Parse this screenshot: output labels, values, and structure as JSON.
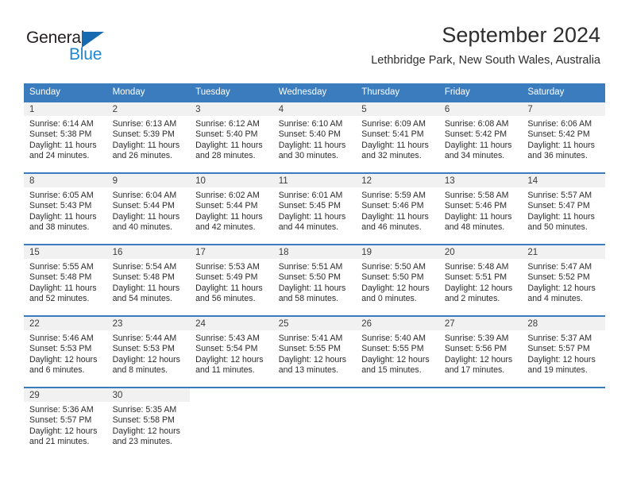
{
  "brand": {
    "name_part1": "General",
    "name_part2": "Blue",
    "triangle_color": "#1769b0",
    "blue_text_color": "#1e87d4"
  },
  "header": {
    "title": "September 2024",
    "subtitle": "Lethbridge Park, New South Wales, Australia",
    "header_bg_color": "#3a7cbe",
    "header_text_color": "#ffffff"
  },
  "weekdays": [
    "Sunday",
    "Monday",
    "Tuesday",
    "Wednesday",
    "Thursday",
    "Friday",
    "Saturday"
  ],
  "weeks": [
    [
      {
        "day": "1",
        "sunrise": "Sunrise: 6:14 AM",
        "sunset": "Sunset: 5:38 PM",
        "daylight_line1": "Daylight: 11 hours",
        "daylight_line2": "and 24 minutes."
      },
      {
        "day": "2",
        "sunrise": "Sunrise: 6:13 AM",
        "sunset": "Sunset: 5:39 PM",
        "daylight_line1": "Daylight: 11 hours",
        "daylight_line2": "and 26 minutes."
      },
      {
        "day": "3",
        "sunrise": "Sunrise: 6:12 AM",
        "sunset": "Sunset: 5:40 PM",
        "daylight_line1": "Daylight: 11 hours",
        "daylight_line2": "and 28 minutes."
      },
      {
        "day": "4",
        "sunrise": "Sunrise: 6:10 AM",
        "sunset": "Sunset: 5:40 PM",
        "daylight_line1": "Daylight: 11 hours",
        "daylight_line2": "and 30 minutes."
      },
      {
        "day": "5",
        "sunrise": "Sunrise: 6:09 AM",
        "sunset": "Sunset: 5:41 PM",
        "daylight_line1": "Daylight: 11 hours",
        "daylight_line2": "and 32 minutes."
      },
      {
        "day": "6",
        "sunrise": "Sunrise: 6:08 AM",
        "sunset": "Sunset: 5:42 PM",
        "daylight_line1": "Daylight: 11 hours",
        "daylight_line2": "and 34 minutes."
      },
      {
        "day": "7",
        "sunrise": "Sunrise: 6:06 AM",
        "sunset": "Sunset: 5:42 PM",
        "daylight_line1": "Daylight: 11 hours",
        "daylight_line2": "and 36 minutes."
      }
    ],
    [
      {
        "day": "8",
        "sunrise": "Sunrise: 6:05 AM",
        "sunset": "Sunset: 5:43 PM",
        "daylight_line1": "Daylight: 11 hours",
        "daylight_line2": "and 38 minutes."
      },
      {
        "day": "9",
        "sunrise": "Sunrise: 6:04 AM",
        "sunset": "Sunset: 5:44 PM",
        "daylight_line1": "Daylight: 11 hours",
        "daylight_line2": "and 40 minutes."
      },
      {
        "day": "10",
        "sunrise": "Sunrise: 6:02 AM",
        "sunset": "Sunset: 5:44 PM",
        "daylight_line1": "Daylight: 11 hours",
        "daylight_line2": "and 42 minutes."
      },
      {
        "day": "11",
        "sunrise": "Sunrise: 6:01 AM",
        "sunset": "Sunset: 5:45 PM",
        "daylight_line1": "Daylight: 11 hours",
        "daylight_line2": "and 44 minutes."
      },
      {
        "day": "12",
        "sunrise": "Sunrise: 5:59 AM",
        "sunset": "Sunset: 5:46 PM",
        "daylight_line1": "Daylight: 11 hours",
        "daylight_line2": "and 46 minutes."
      },
      {
        "day": "13",
        "sunrise": "Sunrise: 5:58 AM",
        "sunset": "Sunset: 5:46 PM",
        "daylight_line1": "Daylight: 11 hours",
        "daylight_line2": "and 48 minutes."
      },
      {
        "day": "14",
        "sunrise": "Sunrise: 5:57 AM",
        "sunset": "Sunset: 5:47 PM",
        "daylight_line1": "Daylight: 11 hours",
        "daylight_line2": "and 50 minutes."
      }
    ],
    [
      {
        "day": "15",
        "sunrise": "Sunrise: 5:55 AM",
        "sunset": "Sunset: 5:48 PM",
        "daylight_line1": "Daylight: 11 hours",
        "daylight_line2": "and 52 minutes."
      },
      {
        "day": "16",
        "sunrise": "Sunrise: 5:54 AM",
        "sunset": "Sunset: 5:48 PM",
        "daylight_line1": "Daylight: 11 hours",
        "daylight_line2": "and 54 minutes."
      },
      {
        "day": "17",
        "sunrise": "Sunrise: 5:53 AM",
        "sunset": "Sunset: 5:49 PM",
        "daylight_line1": "Daylight: 11 hours",
        "daylight_line2": "and 56 minutes."
      },
      {
        "day": "18",
        "sunrise": "Sunrise: 5:51 AM",
        "sunset": "Sunset: 5:50 PM",
        "daylight_line1": "Daylight: 11 hours",
        "daylight_line2": "and 58 minutes."
      },
      {
        "day": "19",
        "sunrise": "Sunrise: 5:50 AM",
        "sunset": "Sunset: 5:50 PM",
        "daylight_line1": "Daylight: 12 hours",
        "daylight_line2": "and 0 minutes."
      },
      {
        "day": "20",
        "sunrise": "Sunrise: 5:48 AM",
        "sunset": "Sunset: 5:51 PM",
        "daylight_line1": "Daylight: 12 hours",
        "daylight_line2": "and 2 minutes."
      },
      {
        "day": "21",
        "sunrise": "Sunrise: 5:47 AM",
        "sunset": "Sunset: 5:52 PM",
        "daylight_line1": "Daylight: 12 hours",
        "daylight_line2": "and 4 minutes."
      }
    ],
    [
      {
        "day": "22",
        "sunrise": "Sunrise: 5:46 AM",
        "sunset": "Sunset: 5:53 PM",
        "daylight_line1": "Daylight: 12 hours",
        "daylight_line2": "and 6 minutes."
      },
      {
        "day": "23",
        "sunrise": "Sunrise: 5:44 AM",
        "sunset": "Sunset: 5:53 PM",
        "daylight_line1": "Daylight: 12 hours",
        "daylight_line2": "and 8 minutes."
      },
      {
        "day": "24",
        "sunrise": "Sunrise: 5:43 AM",
        "sunset": "Sunset: 5:54 PM",
        "daylight_line1": "Daylight: 12 hours",
        "daylight_line2": "and 11 minutes."
      },
      {
        "day": "25",
        "sunrise": "Sunrise: 5:41 AM",
        "sunset": "Sunset: 5:55 PM",
        "daylight_line1": "Daylight: 12 hours",
        "daylight_line2": "and 13 minutes."
      },
      {
        "day": "26",
        "sunrise": "Sunrise: 5:40 AM",
        "sunset": "Sunset: 5:55 PM",
        "daylight_line1": "Daylight: 12 hours",
        "daylight_line2": "and 15 minutes."
      },
      {
        "day": "27",
        "sunrise": "Sunrise: 5:39 AM",
        "sunset": "Sunset: 5:56 PM",
        "daylight_line1": "Daylight: 12 hours",
        "daylight_line2": "and 17 minutes."
      },
      {
        "day": "28",
        "sunrise": "Sunrise: 5:37 AM",
        "sunset": "Sunset: 5:57 PM",
        "daylight_line1": "Daylight: 12 hours",
        "daylight_line2": "and 19 minutes."
      }
    ],
    [
      {
        "day": "29",
        "sunrise": "Sunrise: 5:36 AM",
        "sunset": "Sunset: 5:57 PM",
        "daylight_line1": "Daylight: 12 hours",
        "daylight_line2": "and 21 minutes."
      },
      {
        "day": "30",
        "sunrise": "Sunrise: 5:35 AM",
        "sunset": "Sunset: 5:58 PM",
        "daylight_line1": "Daylight: 12 hours",
        "daylight_line2": "and 23 minutes."
      },
      {
        "day": "",
        "sunrise": "",
        "sunset": "",
        "daylight_line1": "",
        "daylight_line2": ""
      },
      {
        "day": "",
        "sunrise": "",
        "sunset": "",
        "daylight_line1": "",
        "daylight_line2": ""
      },
      {
        "day": "",
        "sunrise": "",
        "sunset": "",
        "daylight_line1": "",
        "daylight_line2": ""
      },
      {
        "day": "",
        "sunrise": "",
        "sunset": "",
        "daylight_line1": "",
        "daylight_line2": ""
      },
      {
        "day": "",
        "sunrise": "",
        "sunset": "",
        "daylight_line1": "",
        "daylight_line2": ""
      }
    ]
  ]
}
